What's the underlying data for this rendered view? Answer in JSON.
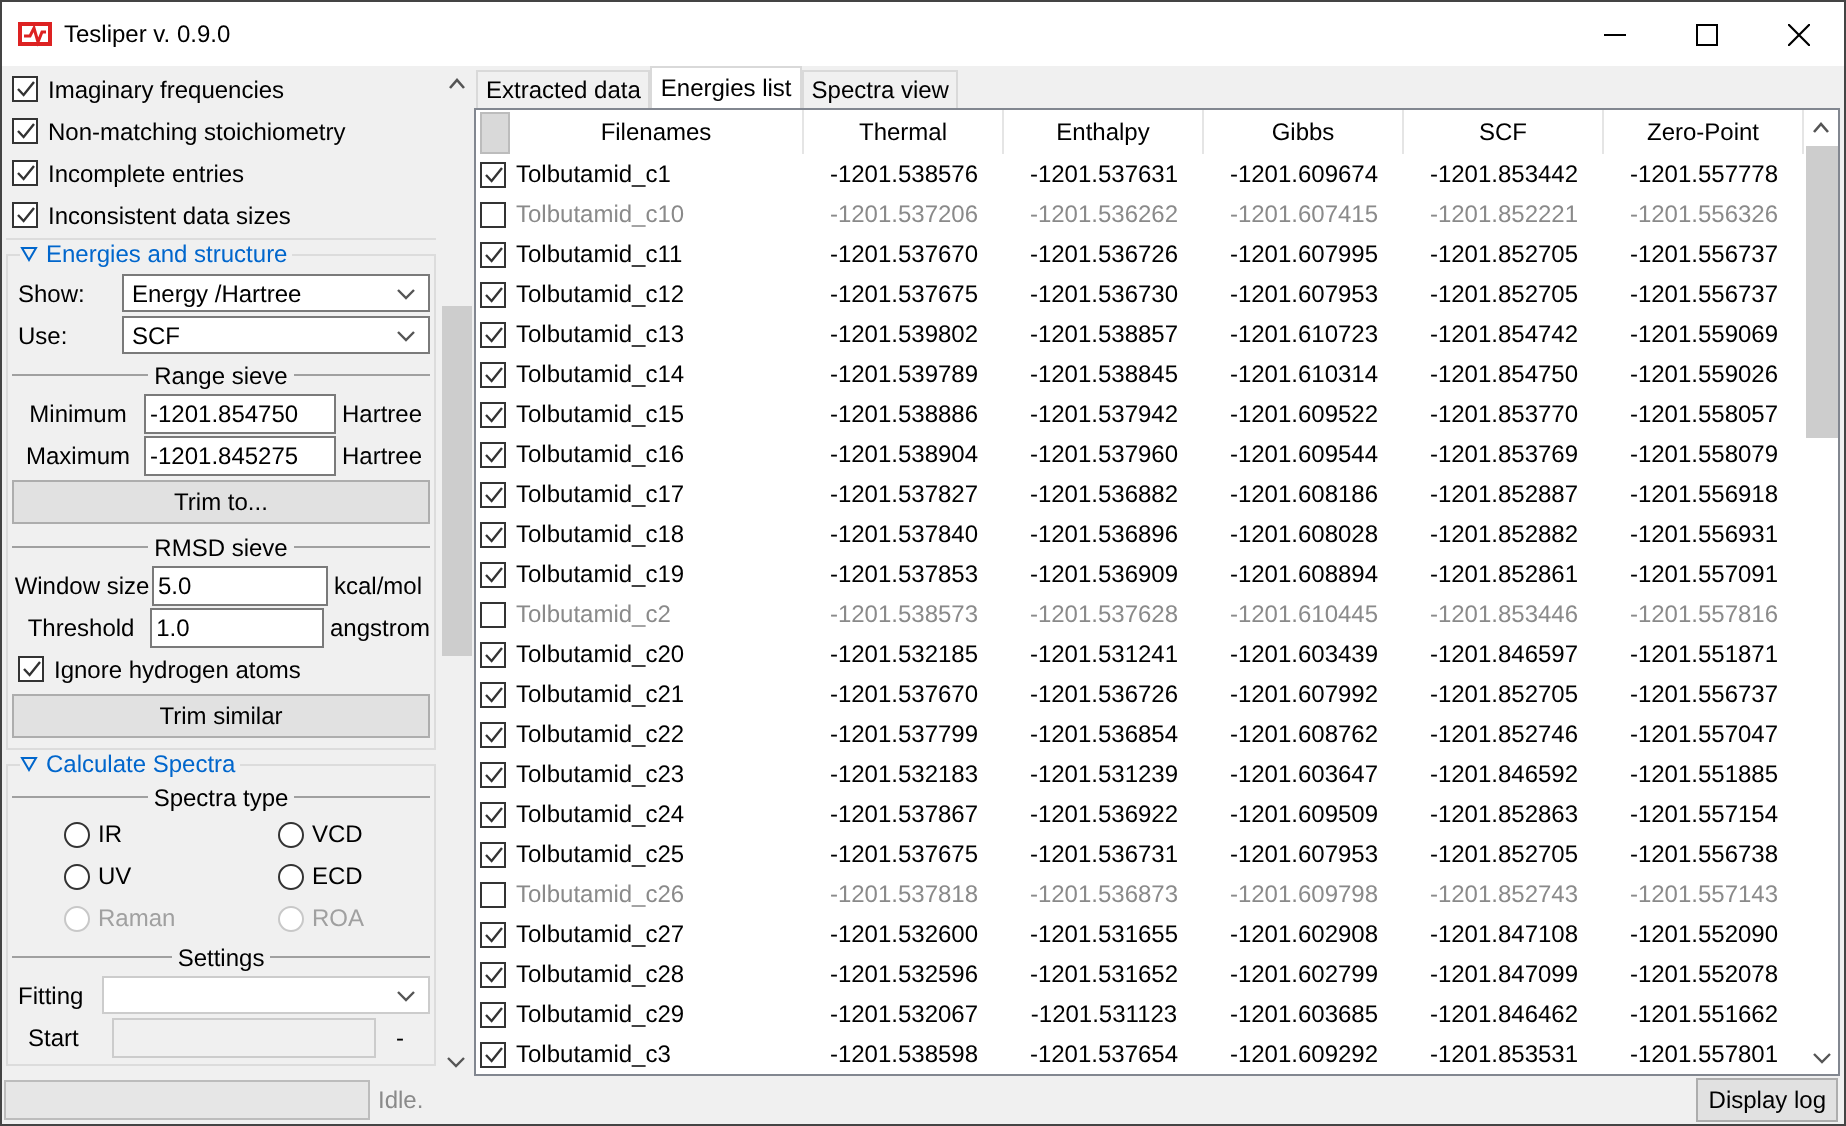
{
  "window": {
    "title": "Tesliper v. 0.9.0"
  },
  "filters": [
    {
      "label": "Imaginary frequencies",
      "checked": true
    },
    {
      "label": "Non-matching stoichiometry",
      "checked": true
    },
    {
      "label": "Incomplete entries",
      "checked": true
    },
    {
      "label": "Inconsistent data sizes",
      "checked": true
    }
  ],
  "energies_section": {
    "title": "Energies and structure",
    "show": {
      "label": "Show:",
      "value": "Energy /Hartree"
    },
    "use": {
      "label": "Use:",
      "value": "SCF"
    },
    "range_sieve": {
      "title": "Range sieve",
      "fields": [
        {
          "label": "Minimum",
          "value": "-1201.854750",
          "unit": "Hartree"
        },
        {
          "label": "Maximum",
          "value": "-1201.845275",
          "unit": "Hartree"
        }
      ],
      "button": "Trim to..."
    },
    "rmsd_sieve": {
      "title": "RMSD sieve",
      "fields": [
        {
          "label": "Window size",
          "value": "5.0",
          "unit": "kcal/mol"
        },
        {
          "label": "Threshold",
          "value": "1.0",
          "unit": "angstrom"
        }
      ],
      "ignore_hydrogen": {
        "label": "Ignore hydrogen atoms",
        "checked": true
      },
      "button": "Trim similar"
    }
  },
  "spectra_section": {
    "title": "Calculate Spectra",
    "spectra_type": {
      "title": "Spectra type",
      "options": [
        {
          "label": "IR",
          "selected": false,
          "disabled": false
        },
        {
          "label": "VCD",
          "selected": false,
          "disabled": false
        },
        {
          "label": "UV",
          "selected": false,
          "disabled": false
        },
        {
          "label": "ECD",
          "selected": false,
          "disabled": false
        },
        {
          "label": "Raman",
          "selected": false,
          "disabled": true
        },
        {
          "label": "ROA",
          "selected": false,
          "disabled": true
        }
      ]
    },
    "settings": {
      "title": "Settings",
      "fitting": {
        "label": "Fitting"
      },
      "start": {
        "label": "Start",
        "separator": "-"
      }
    }
  },
  "tabs": [
    {
      "label": "Extracted data",
      "selected": false
    },
    {
      "label": "Energies list",
      "selected": true
    },
    {
      "label": "Spectra view",
      "selected": false
    }
  ],
  "table": {
    "columns": [
      "Filenames",
      "Thermal",
      "Enthalpy",
      "Gibbs",
      "SCF",
      "Zero-Point"
    ],
    "rows": [
      {
        "checked": true,
        "cells": [
          "Tolbutamid_c1",
          "-1201.538576",
          "-1201.537631",
          "-1201.609674",
          "-1201.853442",
          "-1201.557778"
        ]
      },
      {
        "checked": false,
        "cells": [
          "Tolbutamid_c10",
          "-1201.537206",
          "-1201.536262",
          "-1201.607415",
          "-1201.852221",
          "-1201.556326"
        ]
      },
      {
        "checked": true,
        "cells": [
          "Tolbutamid_c11",
          "-1201.537670",
          "-1201.536726",
          "-1201.607995",
          "-1201.852705",
          "-1201.556737"
        ]
      },
      {
        "checked": true,
        "cells": [
          "Tolbutamid_c12",
          "-1201.537675",
          "-1201.536730",
          "-1201.607953",
          "-1201.852705",
          "-1201.556737"
        ]
      },
      {
        "checked": true,
        "cells": [
          "Tolbutamid_c13",
          "-1201.539802",
          "-1201.538857",
          "-1201.610723",
          "-1201.854742",
          "-1201.559069"
        ]
      },
      {
        "checked": true,
        "cells": [
          "Tolbutamid_c14",
          "-1201.539789",
          "-1201.538845",
          "-1201.610314",
          "-1201.854750",
          "-1201.559026"
        ]
      },
      {
        "checked": true,
        "cells": [
          "Tolbutamid_c15",
          "-1201.538886",
          "-1201.537942",
          "-1201.609522",
          "-1201.853770",
          "-1201.558057"
        ]
      },
      {
        "checked": true,
        "cells": [
          "Tolbutamid_c16",
          "-1201.538904",
          "-1201.537960",
          "-1201.609544",
          "-1201.853769",
          "-1201.558079"
        ]
      },
      {
        "checked": true,
        "cells": [
          "Tolbutamid_c17",
          "-1201.537827",
          "-1201.536882",
          "-1201.608186",
          "-1201.852887",
          "-1201.556918"
        ]
      },
      {
        "checked": true,
        "cells": [
          "Tolbutamid_c18",
          "-1201.537840",
          "-1201.536896",
          "-1201.608028",
          "-1201.852882",
          "-1201.556931"
        ]
      },
      {
        "checked": true,
        "cells": [
          "Tolbutamid_c19",
          "-1201.537853",
          "-1201.536909",
          "-1201.608894",
          "-1201.852861",
          "-1201.557091"
        ]
      },
      {
        "checked": false,
        "cells": [
          "Tolbutamid_c2",
          "-1201.538573",
          "-1201.537628",
          "-1201.610445",
          "-1201.853446",
          "-1201.557816"
        ]
      },
      {
        "checked": true,
        "cells": [
          "Tolbutamid_c20",
          "-1201.532185",
          "-1201.531241",
          "-1201.603439",
          "-1201.846597",
          "-1201.551871"
        ]
      },
      {
        "checked": true,
        "cells": [
          "Tolbutamid_c21",
          "-1201.537670",
          "-1201.536726",
          "-1201.607992",
          "-1201.852705",
          "-1201.556737"
        ]
      },
      {
        "checked": true,
        "cells": [
          "Tolbutamid_c22",
          "-1201.537799",
          "-1201.536854",
          "-1201.608762",
          "-1201.852746",
          "-1201.557047"
        ]
      },
      {
        "checked": true,
        "cells": [
          "Tolbutamid_c23",
          "-1201.532183",
          "-1201.531239",
          "-1201.603647",
          "-1201.846592",
          "-1201.551885"
        ]
      },
      {
        "checked": true,
        "cells": [
          "Tolbutamid_c24",
          "-1201.537867",
          "-1201.536922",
          "-1201.609509",
          "-1201.852863",
          "-1201.557154"
        ]
      },
      {
        "checked": true,
        "cells": [
          "Tolbutamid_c25",
          "-1201.537675",
          "-1201.536731",
          "-1201.607953",
          "-1201.852705",
          "-1201.556738"
        ]
      },
      {
        "checked": false,
        "cells": [
          "Tolbutamid_c26",
          "-1201.537818",
          "-1201.536873",
          "-1201.609798",
          "-1201.852743",
          "-1201.557143"
        ]
      },
      {
        "checked": true,
        "cells": [
          "Tolbutamid_c27",
          "-1201.532600",
          "-1201.531655",
          "-1201.602908",
          "-1201.847108",
          "-1201.552090"
        ]
      },
      {
        "checked": true,
        "cells": [
          "Tolbutamid_c28",
          "-1201.532596",
          "-1201.531652",
          "-1201.602799",
          "-1201.847099",
          "-1201.552078"
        ]
      },
      {
        "checked": true,
        "cells": [
          "Tolbutamid_c29",
          "-1201.532067",
          "-1201.531123",
          "-1201.603685",
          "-1201.846462",
          "-1201.551662"
        ]
      },
      {
        "checked": true,
        "cells": [
          "Tolbutamid_c3",
          "-1201.538598",
          "-1201.537654",
          "-1201.609292",
          "-1201.853531",
          "-1201.557801"
        ]
      }
    ]
  },
  "status_bar": {
    "progress": {
      "level": 0
    },
    "status": "Idle.",
    "button": "Display log"
  }
}
